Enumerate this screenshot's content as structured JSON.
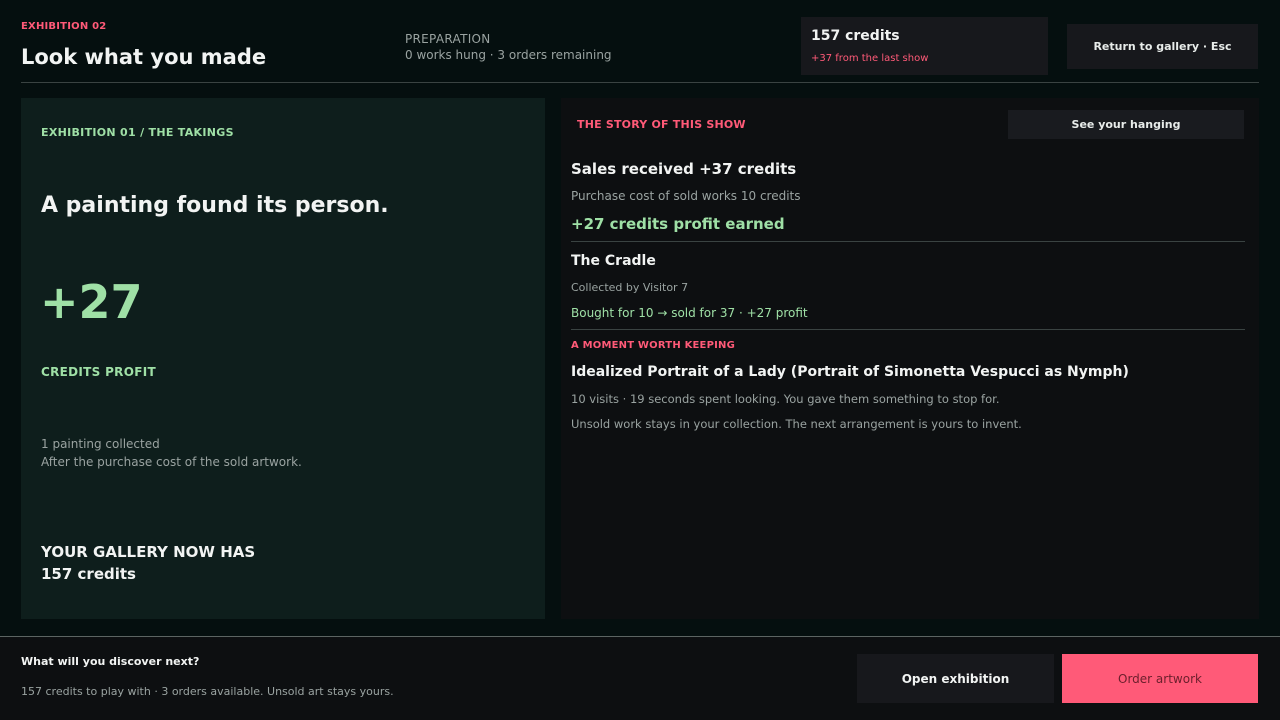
{
  "header": {
    "exhibition_tag": "EXHIBITION 02",
    "title": "Look what you made",
    "phase": "PREPARATION",
    "phase_status": "0 works hung  ·  3 orders remaining",
    "credits": "157 credits",
    "credits_change": "+37 from the last show",
    "return_button": "Return to gallery  ·  Esc"
  },
  "takings": {
    "label": "EXHIBITION 01  /  THE TAKINGS",
    "headline": "A painting found its person.",
    "profit": "+27",
    "profit_label": "CREDITS PROFIT",
    "collected": "1 painting collected",
    "after_cost": "After the purchase cost of the sold artwork.",
    "gallery_now_label": "YOUR GALLERY NOW HAS",
    "gallery_credits": "157 credits"
  },
  "story": {
    "label": "THE STORY OF THIS SHOW",
    "hanging_button": "See your hanging",
    "sales_received": "Sales received  +37 credits",
    "purchase_cost": "Purchase cost of sold works  10 credits",
    "profit_earned": "+27 credits profit earned",
    "sold_work": {
      "title": "The Cradle",
      "collector": "Collected by Visitor 7",
      "trade": "Bought for 10  →  sold for 37  ·  +27 profit"
    },
    "moment": {
      "label": "A MOMENT WORTH KEEPING",
      "title": "Idealized Portrait of a Lady (Portrait of Simonetta Vespucci as Nymph)",
      "stats": "10 visits · 19 seconds spent looking. You gave them something to stop for.",
      "note": "Unsold work stays in your collection. The next arrangement is yours to invent."
    }
  },
  "footer": {
    "question": "What will you discover next?",
    "info": "157 credits to play with · 3 orders available. Unsold art stays yours.",
    "open_button": "Open exhibition",
    "order_button": "Order artwork"
  },
  "colors": {
    "accent": "#ff5a78",
    "positive": "#9fe0a6",
    "background": "#050f0f"
  }
}
